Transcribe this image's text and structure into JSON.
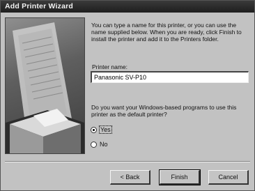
{
  "window": {
    "title": "Add Printer Wizard"
  },
  "intro_text": "You can type a name for this printer, or you can use the name supplied below. When you are ready, click Finish to install the printer and add it to the Printers folder.",
  "printer_name": {
    "label": "Printer name:",
    "value": "Panasonic SV-P10"
  },
  "default_question": "Do you want your Windows-based programs to use this printer as the default printer?",
  "options": [
    {
      "label": "Yes",
      "selected": true
    },
    {
      "label": "No",
      "selected": false
    }
  ],
  "buttons": {
    "back": "< Back",
    "finish": "Finish",
    "cancel": "Cancel"
  },
  "illustration": {
    "icon": "printer-illustration"
  }
}
